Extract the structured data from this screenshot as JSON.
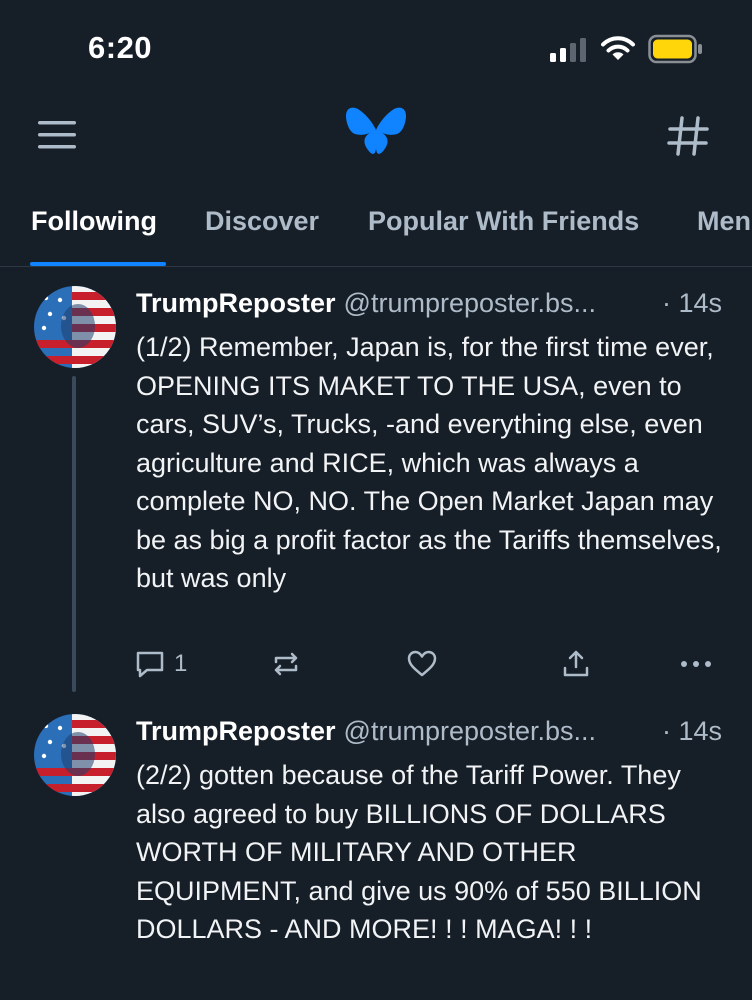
{
  "status_bar": {
    "time": "6:20"
  },
  "tabs": [
    {
      "label": "Following",
      "active": true
    },
    {
      "label": "Discover",
      "active": false
    },
    {
      "label": "Popular With Friends",
      "active": false
    },
    {
      "label": "Men",
      "active": false
    }
  ],
  "icons": {
    "menu": "hamburger-menu-icon",
    "logo": "butterfly-logo",
    "feeds": "hashtag-icon"
  },
  "colors": {
    "accent": "#1083fe",
    "background": "#161e27",
    "muted": "#aebbc9"
  },
  "posts": [
    {
      "author": "TrumpReposter",
      "handle": "@trumpreposter.bs...",
      "time": "· 14s",
      "text": "(1/2) Remember, Japan is, for the first time ever, OPENING ITS MAKET TO THE USA, even to cars, SUV’s, Trucks, -and everything else, even agriculture and RICE, which was always a complete NO, NO. The Open Market Japan may be as big a profit factor as the Tariffs themselves, but was only",
      "reply_count": "1"
    },
    {
      "author": "TrumpReposter",
      "handle": "@trumpreposter.bs...",
      "time": "· 14s",
      "text": "(2/2) gotten because of the Tariff Power. They also agreed to buy BILLIONS OF DOLLARS WORTH OF MILITARY AND OTHER EQUIPMENT, and give us 90% of 550 BILLION DOLLARS - AND MORE! ! ! MAGA! ! !"
    }
  ]
}
